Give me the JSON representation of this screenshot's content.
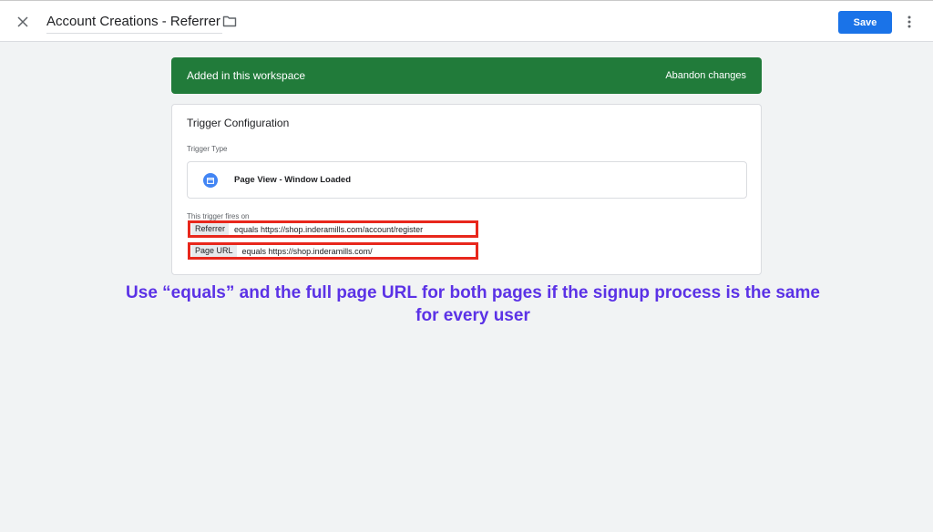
{
  "header": {
    "title": "Account Creations - Referrer",
    "save_label": "Save"
  },
  "banner": {
    "message": "Added in this workspace",
    "action_label": "Abandon changes",
    "color": "#217b3a"
  },
  "trigger_config": {
    "title": "Trigger Configuration",
    "type_label": "Trigger Type",
    "type_value": "Page View - Window Loaded",
    "fires_on_label": "This trigger fires on",
    "conditions": [
      {
        "variable": "Referrer",
        "rest": "equals https://shop.inderamills.com/account/register"
      },
      {
        "variable": "Page URL",
        "rest": "equals https://shop.inderamills.com/"
      }
    ]
  },
  "annotation": {
    "line1": "Use “equals” and the full page URL for both pages if the signup process is the same",
    "line2": "for every user",
    "color": "#5b32e6"
  },
  "colors": {
    "highlight_border": "#e8271c",
    "accent": "#1a73e8"
  },
  "icons": [
    "close-icon",
    "folder-icon",
    "more-vert-icon",
    "page-view-icon"
  ]
}
